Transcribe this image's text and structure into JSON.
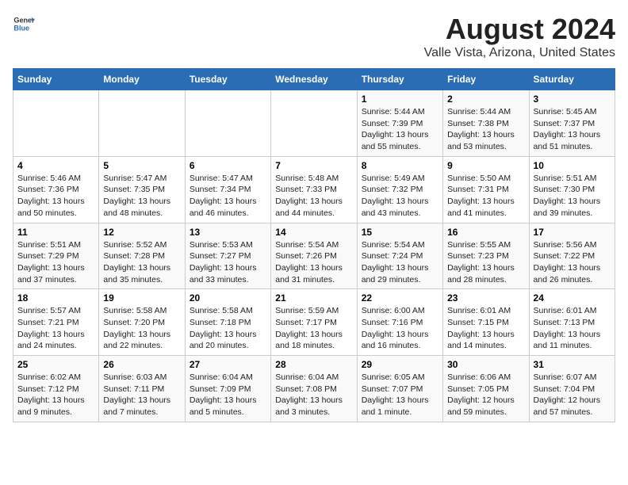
{
  "logo": {
    "general": "General",
    "blue": "Blue"
  },
  "title": "August 2024",
  "subtitle": "Valle Vista, Arizona, United States",
  "days_of_week": [
    "Sunday",
    "Monday",
    "Tuesday",
    "Wednesday",
    "Thursday",
    "Friday",
    "Saturday"
  ],
  "weeks": [
    [
      {
        "day": "",
        "info": ""
      },
      {
        "day": "",
        "info": ""
      },
      {
        "day": "",
        "info": ""
      },
      {
        "day": "",
        "info": ""
      },
      {
        "day": "1",
        "info": "Sunrise: 5:44 AM\nSunset: 7:39 PM\nDaylight: 13 hours\nand 55 minutes."
      },
      {
        "day": "2",
        "info": "Sunrise: 5:44 AM\nSunset: 7:38 PM\nDaylight: 13 hours\nand 53 minutes."
      },
      {
        "day": "3",
        "info": "Sunrise: 5:45 AM\nSunset: 7:37 PM\nDaylight: 13 hours\nand 51 minutes."
      }
    ],
    [
      {
        "day": "4",
        "info": "Sunrise: 5:46 AM\nSunset: 7:36 PM\nDaylight: 13 hours\nand 50 minutes."
      },
      {
        "day": "5",
        "info": "Sunrise: 5:47 AM\nSunset: 7:35 PM\nDaylight: 13 hours\nand 48 minutes."
      },
      {
        "day": "6",
        "info": "Sunrise: 5:47 AM\nSunset: 7:34 PM\nDaylight: 13 hours\nand 46 minutes."
      },
      {
        "day": "7",
        "info": "Sunrise: 5:48 AM\nSunset: 7:33 PM\nDaylight: 13 hours\nand 44 minutes."
      },
      {
        "day": "8",
        "info": "Sunrise: 5:49 AM\nSunset: 7:32 PM\nDaylight: 13 hours\nand 43 minutes."
      },
      {
        "day": "9",
        "info": "Sunrise: 5:50 AM\nSunset: 7:31 PM\nDaylight: 13 hours\nand 41 minutes."
      },
      {
        "day": "10",
        "info": "Sunrise: 5:51 AM\nSunset: 7:30 PM\nDaylight: 13 hours\nand 39 minutes."
      }
    ],
    [
      {
        "day": "11",
        "info": "Sunrise: 5:51 AM\nSunset: 7:29 PM\nDaylight: 13 hours\nand 37 minutes."
      },
      {
        "day": "12",
        "info": "Sunrise: 5:52 AM\nSunset: 7:28 PM\nDaylight: 13 hours\nand 35 minutes."
      },
      {
        "day": "13",
        "info": "Sunrise: 5:53 AM\nSunset: 7:27 PM\nDaylight: 13 hours\nand 33 minutes."
      },
      {
        "day": "14",
        "info": "Sunrise: 5:54 AM\nSunset: 7:26 PM\nDaylight: 13 hours\nand 31 minutes."
      },
      {
        "day": "15",
        "info": "Sunrise: 5:54 AM\nSunset: 7:24 PM\nDaylight: 13 hours\nand 29 minutes."
      },
      {
        "day": "16",
        "info": "Sunrise: 5:55 AM\nSunset: 7:23 PM\nDaylight: 13 hours\nand 28 minutes."
      },
      {
        "day": "17",
        "info": "Sunrise: 5:56 AM\nSunset: 7:22 PM\nDaylight: 13 hours\nand 26 minutes."
      }
    ],
    [
      {
        "day": "18",
        "info": "Sunrise: 5:57 AM\nSunset: 7:21 PM\nDaylight: 13 hours\nand 24 minutes."
      },
      {
        "day": "19",
        "info": "Sunrise: 5:58 AM\nSunset: 7:20 PM\nDaylight: 13 hours\nand 22 minutes."
      },
      {
        "day": "20",
        "info": "Sunrise: 5:58 AM\nSunset: 7:18 PM\nDaylight: 13 hours\nand 20 minutes."
      },
      {
        "day": "21",
        "info": "Sunrise: 5:59 AM\nSunset: 7:17 PM\nDaylight: 13 hours\nand 18 minutes."
      },
      {
        "day": "22",
        "info": "Sunrise: 6:00 AM\nSunset: 7:16 PM\nDaylight: 13 hours\nand 16 minutes."
      },
      {
        "day": "23",
        "info": "Sunrise: 6:01 AM\nSunset: 7:15 PM\nDaylight: 13 hours\nand 14 minutes."
      },
      {
        "day": "24",
        "info": "Sunrise: 6:01 AM\nSunset: 7:13 PM\nDaylight: 13 hours\nand 11 minutes."
      }
    ],
    [
      {
        "day": "25",
        "info": "Sunrise: 6:02 AM\nSunset: 7:12 PM\nDaylight: 13 hours\nand 9 minutes."
      },
      {
        "day": "26",
        "info": "Sunrise: 6:03 AM\nSunset: 7:11 PM\nDaylight: 13 hours\nand 7 minutes."
      },
      {
        "day": "27",
        "info": "Sunrise: 6:04 AM\nSunset: 7:09 PM\nDaylight: 13 hours\nand 5 minutes."
      },
      {
        "day": "28",
        "info": "Sunrise: 6:04 AM\nSunset: 7:08 PM\nDaylight: 13 hours\nand 3 minutes."
      },
      {
        "day": "29",
        "info": "Sunrise: 6:05 AM\nSunset: 7:07 PM\nDaylight: 13 hours\nand 1 minute."
      },
      {
        "day": "30",
        "info": "Sunrise: 6:06 AM\nSunset: 7:05 PM\nDaylight: 12 hours\nand 59 minutes."
      },
      {
        "day": "31",
        "info": "Sunrise: 6:07 AM\nSunset: 7:04 PM\nDaylight: 12 hours\nand 57 minutes."
      }
    ]
  ]
}
